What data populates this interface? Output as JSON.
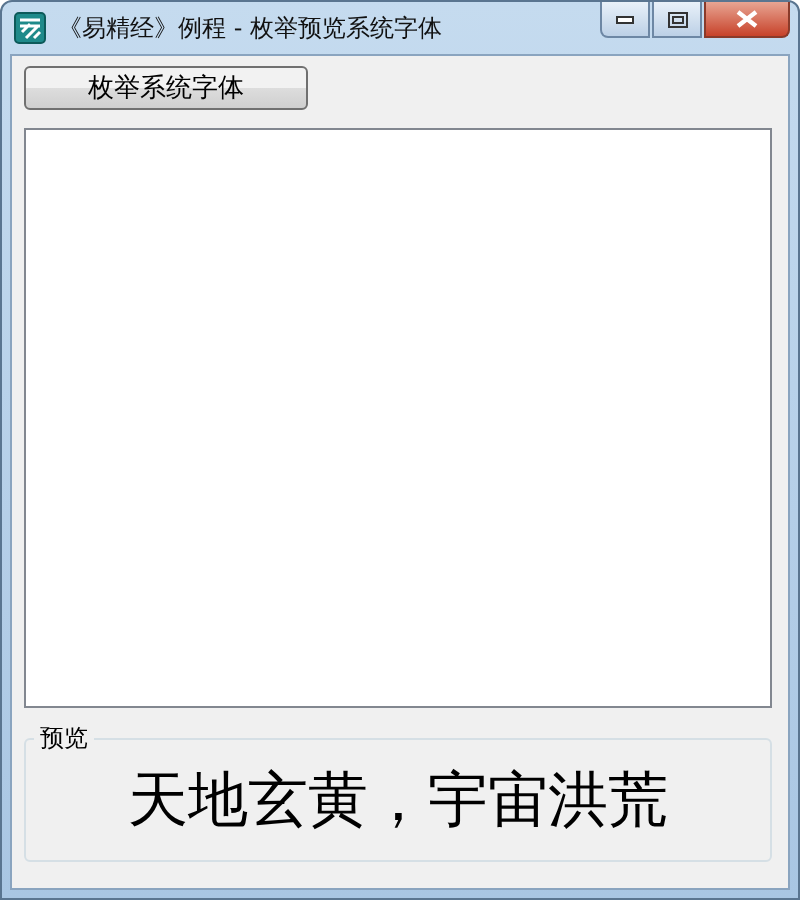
{
  "window": {
    "title": "《易精经》例程 - 枚举预览系统字体"
  },
  "enumerate_button": {
    "label": "枚举系统字体"
  },
  "preview": {
    "label": "预览",
    "sample": "天地玄黄，宇宙洪荒"
  }
}
